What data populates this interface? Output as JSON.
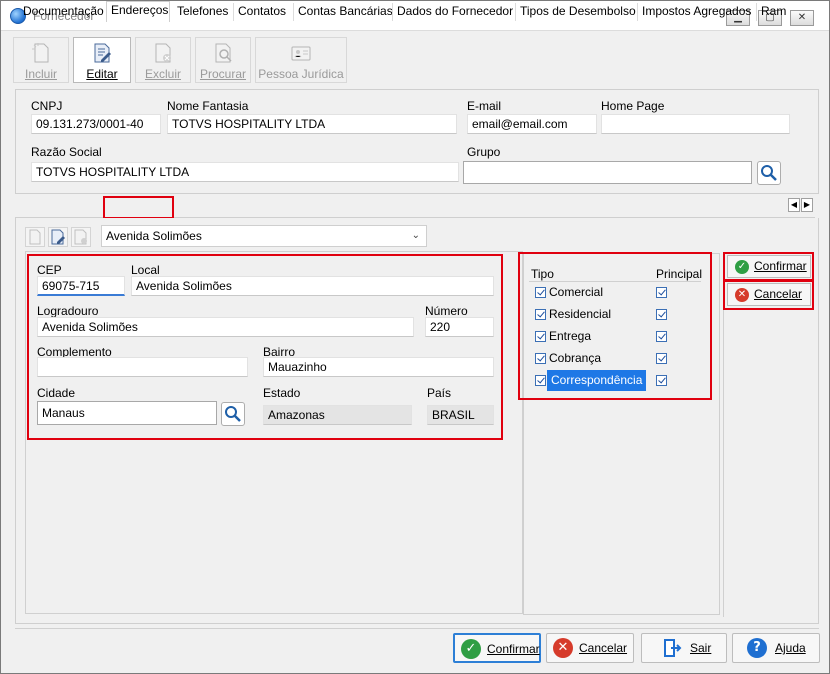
{
  "window": {
    "title": "Fornecedor"
  },
  "toolbar": {
    "incluir": "Incluir",
    "editar": "Editar",
    "excluir": "Excluir",
    "procurar": "Procurar",
    "pessoa_juridica": "Pessoa Jurídica"
  },
  "header": {
    "cnpj_label": "CNPJ",
    "cnpj_value": "09.131.273/0001-40",
    "nome_fantasia_label": "Nome Fantasia",
    "nome_fantasia_value": "TOTVS HOSPITALITY LTDA",
    "email_label": "E-mail",
    "email_value": "email@email.com",
    "home_page_label": "Home Page",
    "home_page_value": "",
    "razao_social_label": "Razão Social",
    "razao_social_value": "TOTVS HOSPITALITY LTDA",
    "grupo_label": "Grupo",
    "grupo_value": ""
  },
  "tabs": [
    "Documentação",
    "Endereços",
    "Telefones",
    "Contatos",
    "Contas Bancárias",
    "Dados do Fornecedor",
    "Tipos de Desembolso",
    "Impostos Agregados",
    "Ram"
  ],
  "address_selector": {
    "value": "Avenida Solimões"
  },
  "address": {
    "cep_label": "CEP",
    "cep_value": "69075-715",
    "local_label": "Local",
    "local_value": "Avenida Solimões",
    "logradouro_label": "Logradouro",
    "logradouro_value": "Avenida Solimões",
    "numero_label": "Número",
    "numero_value": "220",
    "complemento_label": "Complemento",
    "complemento_value": "",
    "bairro_label": "Bairro",
    "bairro_value": "Mauazinho",
    "cidade_label": "Cidade",
    "cidade_value": "Manaus",
    "estado_label": "Estado",
    "estado_value": "Amazonas",
    "pais_label": "País",
    "pais_value": "BRASIL"
  },
  "tipos": {
    "tipo_header": "Tipo",
    "principal_header": "Principal",
    "rows": [
      "Comercial",
      "Residencial",
      "Entrega",
      "Cobrança",
      "Correspondência"
    ]
  },
  "side_actions": {
    "confirmar": "Confirmar",
    "cancelar": "Cancelar"
  },
  "footer": {
    "confirmar": "Confirmar",
    "cancelar": "Cancelar",
    "sair": "Sair",
    "ajuda": "Ajuda"
  },
  "colors": {
    "highlight_red": "#e0000f",
    "selection_blue": "#1e78e6",
    "confirm_green": "#2f9e44",
    "cancel_red": "#d63b2b",
    "help_blue": "#1f6fd1"
  }
}
